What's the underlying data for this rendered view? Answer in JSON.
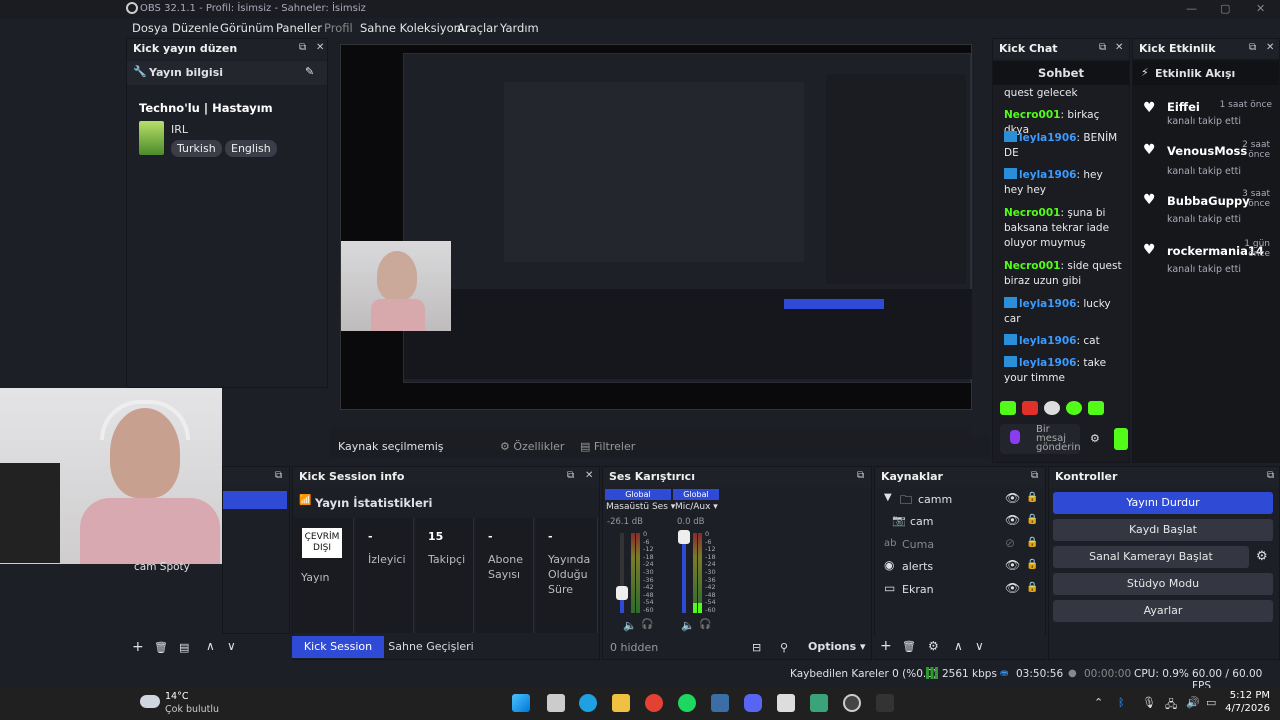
{
  "window": {
    "title": "OBS 32.1.1 - Profil: İsimsiz - Sahneler: İsimsiz"
  },
  "menu": [
    "Dosya",
    "Düzenle",
    "Görünüm",
    "Paneller",
    "Profil",
    "Sahne Koleksiyonu",
    "Araçlar",
    "Yardım"
  ],
  "stream_dock": {
    "title": "Kick yayın düzen",
    "section": "Yayın bilgisi",
    "stream_title": "Techno'lu | Hastayım",
    "category": "IRL",
    "tags": [
      "Turkish",
      "English"
    ]
  },
  "preview": {
    "status": "Kaynak seçilmemiş",
    "properties_button": "Özellikler",
    "filters_button": "Filtreler"
  },
  "webcam_overlay": {
    "label": "cam Spoty"
  },
  "kick_chat": {
    "title": "Kick Chat",
    "tab": "Sohbet",
    "messages": [
      {
        "user": "",
        "text": "quest gelecek"
      },
      {
        "user": "Necro001",
        "text": "birkaç dkya",
        "color": "green"
      },
      {
        "user": "leyla1906",
        "text": "BENİM DE",
        "color": "blue"
      },
      {
        "user": "leyla1906",
        "text": "hey hey hey",
        "color": "blue"
      },
      {
        "user": "Necro001",
        "text": "şuna bi baksana tekrar iade oluyor muymuş",
        "color": "green"
      },
      {
        "user": "Necro001",
        "text": "side quest biraz uzun gibi",
        "color": "green"
      },
      {
        "user": "leyla1906",
        "text": "lucky car",
        "color": "blue"
      },
      {
        "user": "leyla1906",
        "text": "cat",
        "color": "blue"
      },
      {
        "user": "leyla1906",
        "text": "take your timme",
        "color": "blue"
      }
    ],
    "input_placeholder": "Bir mesaj gönderin"
  },
  "kick_events": {
    "title": "Kick Etkinlik",
    "feed_title": "Etkinlik Akışı",
    "events": [
      {
        "name": "Eiffei",
        "time": "1 saat önce",
        "desc": "kanalı takip etti"
      },
      {
        "name": "VenousMoss",
        "time": "2 saat önce",
        "desc": "kanalı takip etti"
      },
      {
        "name": "BubbaGuppy",
        "time": "3 saat önce",
        "desc": "kanalı takip etti"
      },
      {
        "name": "rockermania14",
        "time": "1 gün önce",
        "desc": "kanalı takip etti"
      }
    ]
  },
  "session": {
    "title": "Kick Session info",
    "heading": "Yayın İstatistikleri",
    "offline_badge": "ÇEVRİM DIŞI",
    "stats": [
      {
        "value": "",
        "label": "Yayın"
      },
      {
        "value": "-",
        "label": "İzleyici"
      },
      {
        "value": "15",
        "label": "Takipçi"
      },
      {
        "value": "-",
        "label": "Abone Sayısı"
      },
      {
        "value": "-",
        "label": "Yayında Olduğu Süre"
      }
    ],
    "tabs": [
      "Kick Session info",
      "Sahne Geçişleri"
    ]
  },
  "mixer": {
    "title": "Ses Karıştırıcı",
    "channels": [
      {
        "group": "Global",
        "name": "Masaüstü Ses",
        "db": "-26.1 dB",
        "level": 0.25
      },
      {
        "group": "Global",
        "name": "Mic/Aux",
        "db": "0.0 dB",
        "level": 0.95
      }
    ],
    "scale": [
      "0",
      "-6",
      "-12",
      "-18",
      "-24",
      "-30",
      "-36",
      "-42",
      "-48",
      "-54",
      "-60"
    ],
    "hidden": "0 hidden",
    "options": "Options"
  },
  "sources": {
    "title": "Kaynaklar",
    "items": [
      {
        "name": "camm",
        "type": "group"
      },
      {
        "name": "cam",
        "type": "camera"
      },
      {
        "name": "Cuma",
        "type": "text",
        "hidden": true
      },
      {
        "name": "alerts",
        "type": "browser"
      },
      {
        "name": "Ekran",
        "type": "display"
      }
    ]
  },
  "controls": {
    "title": "Kontroller",
    "buttons": [
      "Yayını Durdur",
      "Kaydı Başlat",
      "Sanal Kamerayı Başlat",
      "Stüdyo Modu",
      "Ayarlar"
    ]
  },
  "statusbar": {
    "dropped": "Kaybedilen Kareler 0 (%0.0)",
    "bitrate": "2561 kbps",
    "stream_time": "03:50:56",
    "rec_time": "00:00:00",
    "cpu": "CPU: 0.9%",
    "fps": "60.00 / 60.00 FPS"
  },
  "taskbar": {
    "weather_temp": "14°C",
    "weather_desc": "Çok bulutlu",
    "time": "5:12 PM",
    "date": "4/7/2026"
  },
  "colors": {
    "accent": "#2f4bd6",
    "kick_green": "#53fc18",
    "chat_blue": "#3b9cff"
  }
}
